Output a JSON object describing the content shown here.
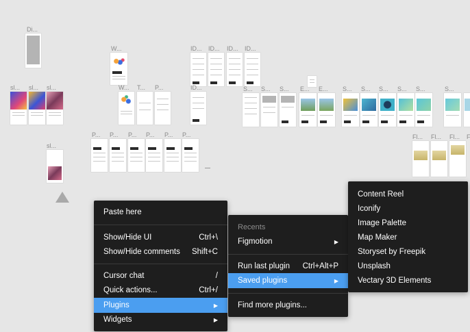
{
  "canvas": {
    "labels": {
      "di": "Di...",
      "w1": "W...",
      "id1": "ID...",
      "id2": "ID...",
      "id3": "ID...",
      "id4": "ID...",
      "sl1": "sl...",
      "sl2": "sl...",
      "sl3": "sl...",
      "w2": "W...",
      "t": "T...",
      "p1": "P...",
      "id5": "ID...",
      "s1": "S...",
      "s2": "S...",
      "s3": "S...",
      "e1": "E...",
      "e2": "E...",
      "s4": "S...",
      "s5": "S...",
      "s6": "S...",
      "s7": "S...",
      "s8": "S...",
      "s9": "S...",
      "sl4": "sl...",
      "p2": "P...",
      "p3": "P...",
      "p4": "P...",
      "p5": "P...",
      "p6": "P...",
      "p7": "P...",
      "fl1": "Fl...",
      "fl2": "Fl...",
      "fl3": "Fl...",
      "f4": "F"
    }
  },
  "context_menu": {
    "items": {
      "paste_here": "Paste here",
      "show_hide_ui": "Show/Hide UI",
      "show_hide_ui_shortcut": "Ctrl+\\",
      "show_hide_comments": "Show/Hide comments",
      "show_hide_comments_shortcut": "Shift+C",
      "cursor_chat": "Cursor chat",
      "cursor_chat_shortcut": "/",
      "quick_actions": "Quick actions...",
      "quick_actions_shortcut": "Ctrl+/",
      "plugins": "Plugins",
      "widgets": "Widgets"
    }
  },
  "plugins_menu": {
    "recents_header": "Recents",
    "figmotion": "Figmotion",
    "run_last_plugin": "Run last plugin",
    "run_last_plugin_shortcut": "Ctrl+Alt+P",
    "saved_plugins": "Saved plugins",
    "find_more_plugins": "Find more plugins..."
  },
  "saved_plugins_menu": {
    "items": [
      "Content Reel",
      "Iconify",
      "Image Palette",
      "Map Maker",
      "Storyset by Freepik",
      "Unsplash",
      "Vectary 3D Elements"
    ]
  },
  "colors": {
    "menu_bg": "#1e1e1e",
    "highlight": "#4b9ef0",
    "canvas_bg": "#e6e6e6"
  }
}
